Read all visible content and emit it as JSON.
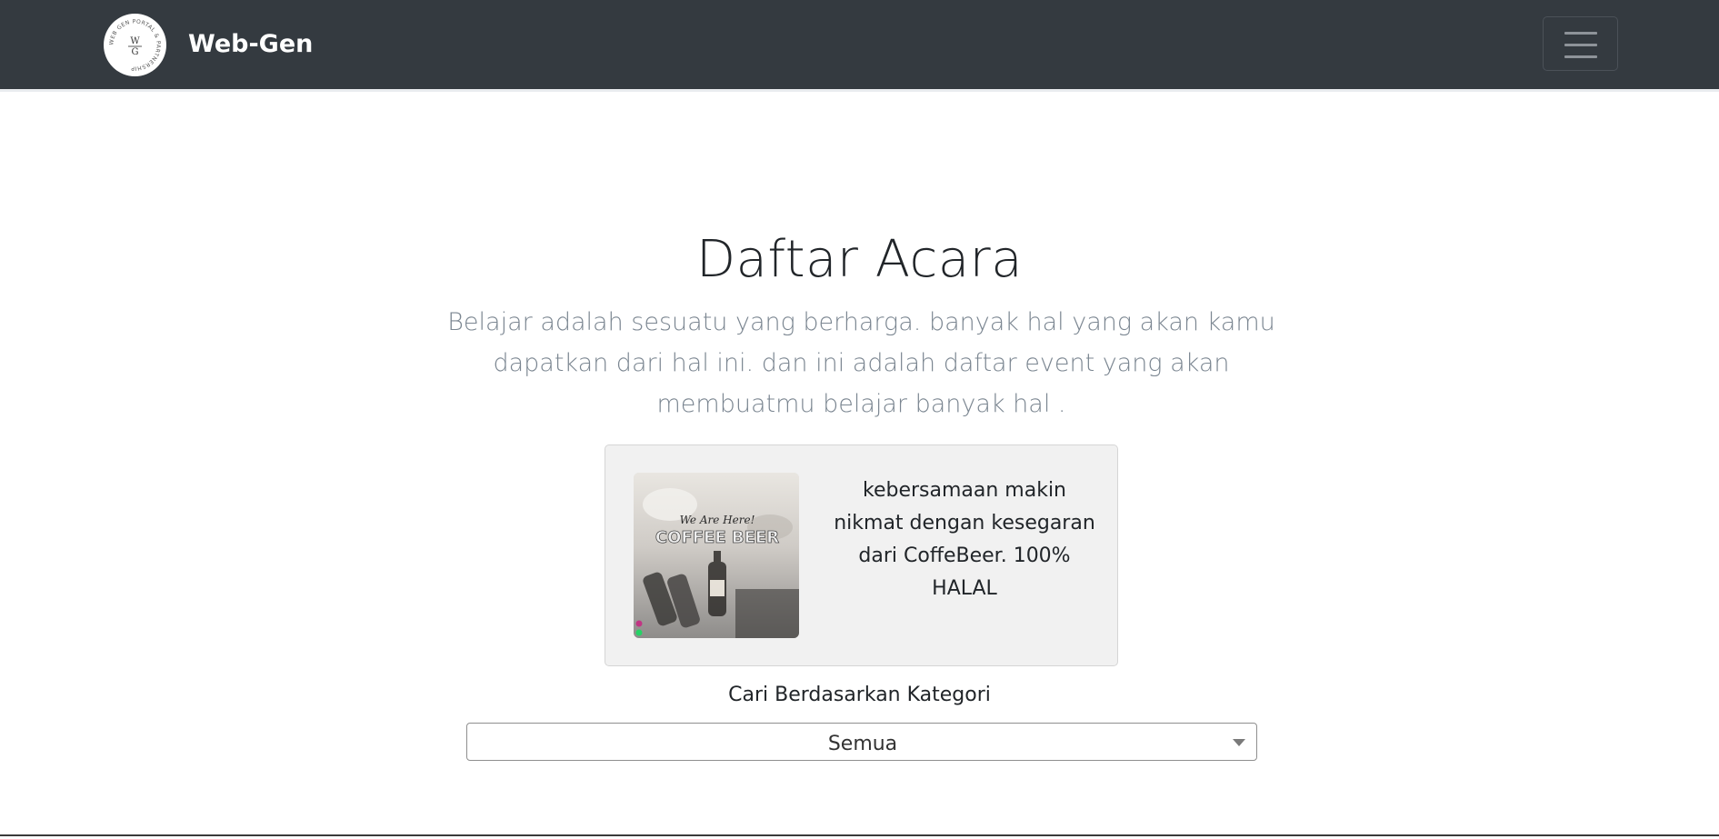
{
  "navbar": {
    "brand_name": "Web-Gen",
    "logo_letters": "W G",
    "logo_ring_text": "WEB GEN PORTAL & PARTNERSHIP",
    "toggler_icon": "hamburger-menu-icon",
    "background": "#343a40"
  },
  "header": {
    "title": "Daftar Acara",
    "lead": "Belajar adalah sesuatu yang berharga. banyak hal yang akan kamu dapatkan dari hal ini. dan ini adalah daftar event yang akan membuatmu belajar banyak hal ."
  },
  "events": [
    {
      "image_text_top": "We Are Here!",
      "image_text_main": "COFFEE BEER",
      "description": "kebersamaan makin nikmat dengan kesegaran dari CoffeBeer. 100% HALAL"
    }
  ],
  "filter": {
    "label": "Cari Berdasarkan Kategori",
    "selected": "Semua",
    "caret_icon": "chevron-down-icon"
  }
}
